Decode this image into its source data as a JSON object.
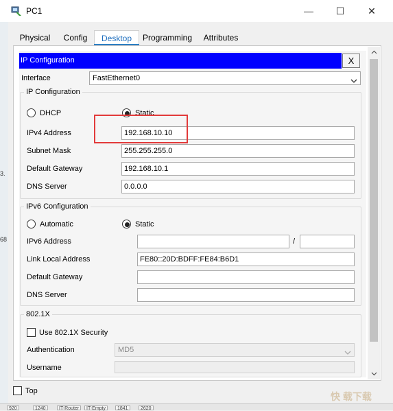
{
  "window": {
    "title": "PC1",
    "controls": {
      "minimize": "—",
      "maximize": "☐",
      "close": "✕"
    }
  },
  "tabs": [
    {
      "label": "Physical",
      "active": false
    },
    {
      "label": "Config",
      "active": false
    },
    {
      "label": "Desktop",
      "active": true
    },
    {
      "label": "Programming",
      "active": false
    },
    {
      "label": "Attributes",
      "active": false
    }
  ],
  "ip_config": {
    "header": "IP Configuration",
    "close_label": "X",
    "interface_label": "Interface",
    "interface_value": "FastEthernet0",
    "ipv4": {
      "group_title": "IP Configuration",
      "dhcp_label": "DHCP",
      "static_label": "Static",
      "mode": "static",
      "fields": [
        {
          "label": "IPv4 Address",
          "value": "192.168.10.10"
        },
        {
          "label": "Subnet Mask",
          "value": "255.255.255.0"
        },
        {
          "label": "Default Gateway",
          "value": "192.168.10.1"
        },
        {
          "label": "DNS Server",
          "value": "0.0.0.0"
        }
      ]
    },
    "ipv6": {
      "group_title": "IPv6 Configuration",
      "automatic_label": "Automatic",
      "static_label": "Static",
      "mode": "static",
      "address_label": "IPv6 Address",
      "address_value": "",
      "slash": "/",
      "prefix_value": "",
      "link_local_label": "Link Local Address",
      "link_local_value": "FE80::20D:BDFF:FE84:B6D1",
      "gateway_label": "Default Gateway",
      "gateway_value": "",
      "dns_label": "DNS Server",
      "dns_value": ""
    },
    "dot1x": {
      "group_title": "802.1X",
      "use_security_label": "Use 802.1X Security",
      "use_security_checked": false,
      "auth_label": "Authentication",
      "auth_value": "MD5",
      "username_label": "Username",
      "username_value": ""
    }
  },
  "footer": {
    "top_label": "Top",
    "top_checked": false
  },
  "background": {
    "left_fragments": [
      "3.",
      "68"
    ],
    "bottom_chips": [
      "920",
      "1240",
      "IT-Router",
      "IT-Empty",
      "1841",
      "2620"
    ]
  },
  "watermark": "快 载下载",
  "colors": {
    "header_blue": "#0000ff",
    "active_tab_text": "#1f6fbf",
    "highlight_red": "#e23a3a"
  },
  "icons": {
    "app": "packet-tracer-pc-icon",
    "dropdown": "chevron-down-icon",
    "scroll_up": "arrow-up-icon",
    "scroll_down": "arrow-down-icon"
  }
}
